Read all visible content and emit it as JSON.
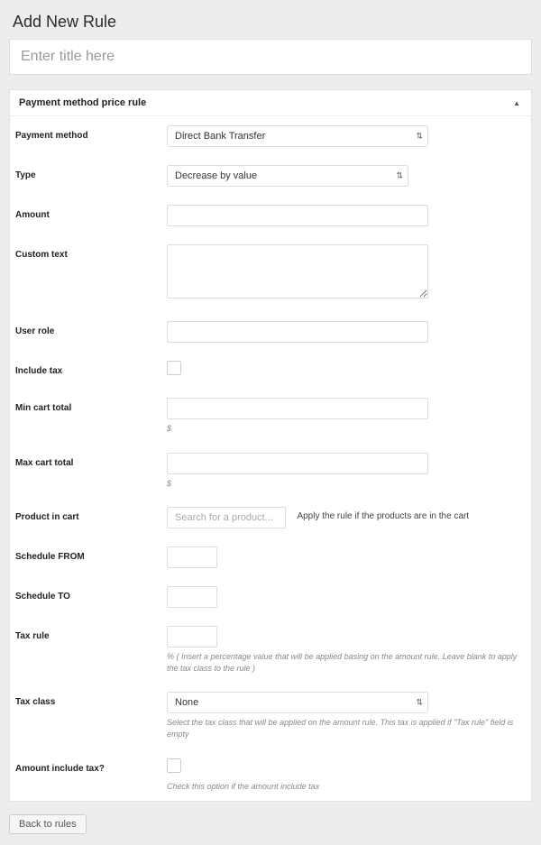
{
  "page": {
    "heading": "Add New Rule",
    "title_placeholder": "Enter title here",
    "back_button": "Back to rules"
  },
  "metabox": {
    "title": "Payment method price rule"
  },
  "fields": {
    "payment_method": {
      "label": "Payment method",
      "value": "Direct Bank Transfer"
    },
    "type": {
      "label": "Type",
      "value": "Decrease by value"
    },
    "amount": {
      "label": "Amount",
      "value": ""
    },
    "custom_text": {
      "label": "Custom text",
      "value": ""
    },
    "user_role": {
      "label": "User role",
      "value": ""
    },
    "include_tax": {
      "label": "Include tax",
      "checked": false
    },
    "min_cart_total": {
      "label": "Min cart total",
      "value": "",
      "suffix": "$"
    },
    "max_cart_total": {
      "label": "Max cart total",
      "value": "",
      "suffix": "$"
    },
    "product_in_cart": {
      "label": "Product in cart",
      "placeholder": "Search for a product...",
      "note": "Apply the rule if the products are in the cart"
    },
    "schedule_from": {
      "label": "Schedule FROM",
      "value": ""
    },
    "schedule_to": {
      "label": "Schedule TO",
      "value": ""
    },
    "tax_rule": {
      "label": "Tax rule",
      "value": "",
      "hint": "% ( Insert a percentage value that will be applied basing on the amount rule. Leave blank to apply the tax class to the rule )"
    },
    "tax_class": {
      "label": "Tax class",
      "value": "None",
      "hint": "Select the tax class that will be applied on the amount rule. This tax is applied if \"Tax rule\" field is empty"
    },
    "amount_include_tax": {
      "label": "Amount include tax?",
      "checked": false,
      "hint": "Check this option if the amount include tax"
    }
  }
}
